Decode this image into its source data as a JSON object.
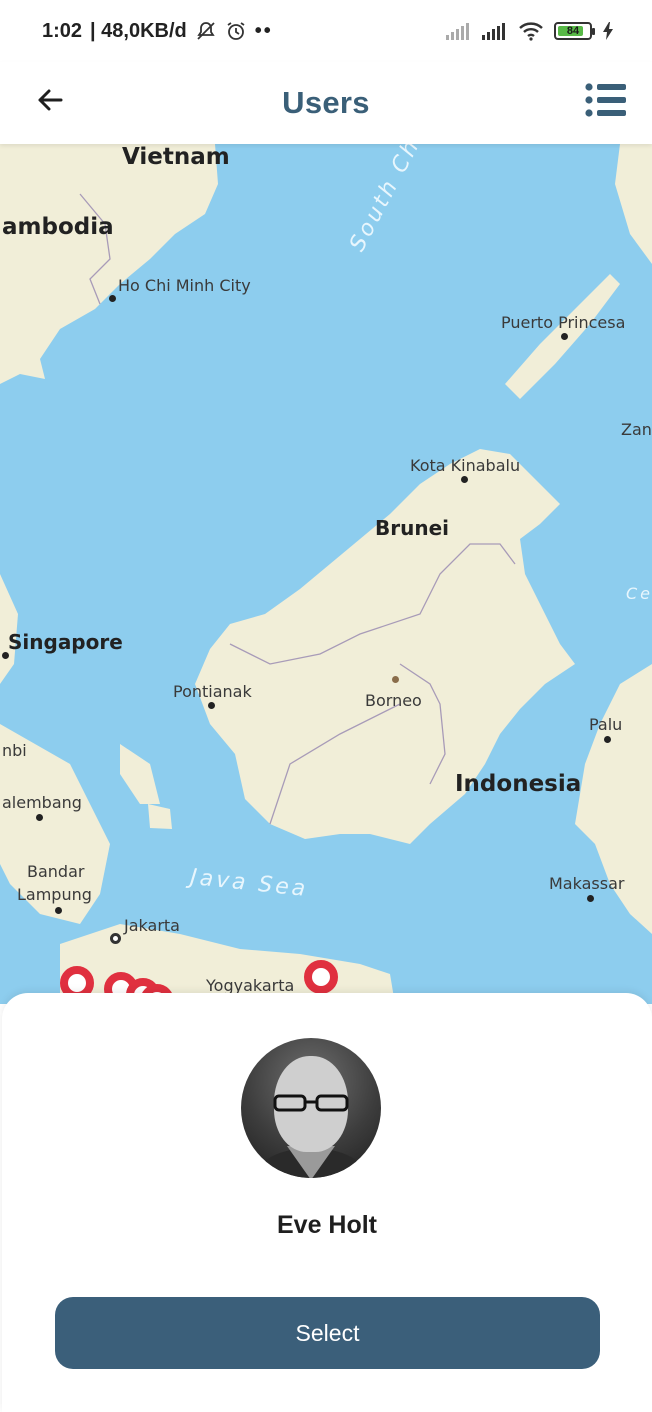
{
  "status_bar": {
    "time": "1:02",
    "network_speed": "| 48,0KB/d",
    "battery_level": "84",
    "battery_fraction": 0.84,
    "icons": [
      "notification-off-icon",
      "alarm-icon",
      "more-dots-icon",
      "signal-icon",
      "signal-icon",
      "wifi-icon",
      "battery-icon",
      "charging-icon"
    ]
  },
  "header": {
    "title": "Users",
    "back_icon": "arrow-left-icon",
    "menu_icon": "list-icon"
  },
  "map": {
    "labels": {
      "vietnam": "Vietnam",
      "cambodia": "ambodia",
      "ho_chi_minh": "Ho Chi Minh City",
      "south_china": "South Ch",
      "puerto_princesa": "Puerto Princesa",
      "zan": "Zan",
      "kota_kinabalu": "Kota Kinabalu",
      "brunei": "Brunei",
      "singapore": "Singapore",
      "pontianak": "Pontianak",
      "borneo": "Borneo",
      "nbi": "nbi",
      "palu": "Palu",
      "indonesia": "Indonesia",
      "palembang": "alembang",
      "bandar": "Bandar",
      "lampung": "Lampung",
      "java_sea": "Java Sea",
      "makassar": "Makassar",
      "jakarta": "Jakarta",
      "yogyakarta": "Yogyakarta",
      "ce": "Ce"
    },
    "colors": {
      "water": "#8dcdee",
      "land": "#f1eed8",
      "pin": "#e0303f"
    }
  },
  "user": {
    "name": "Eve Holt",
    "avatar": "user-avatar"
  },
  "actions": {
    "select_label": "Select",
    "button_color": "#3b5f7a"
  }
}
